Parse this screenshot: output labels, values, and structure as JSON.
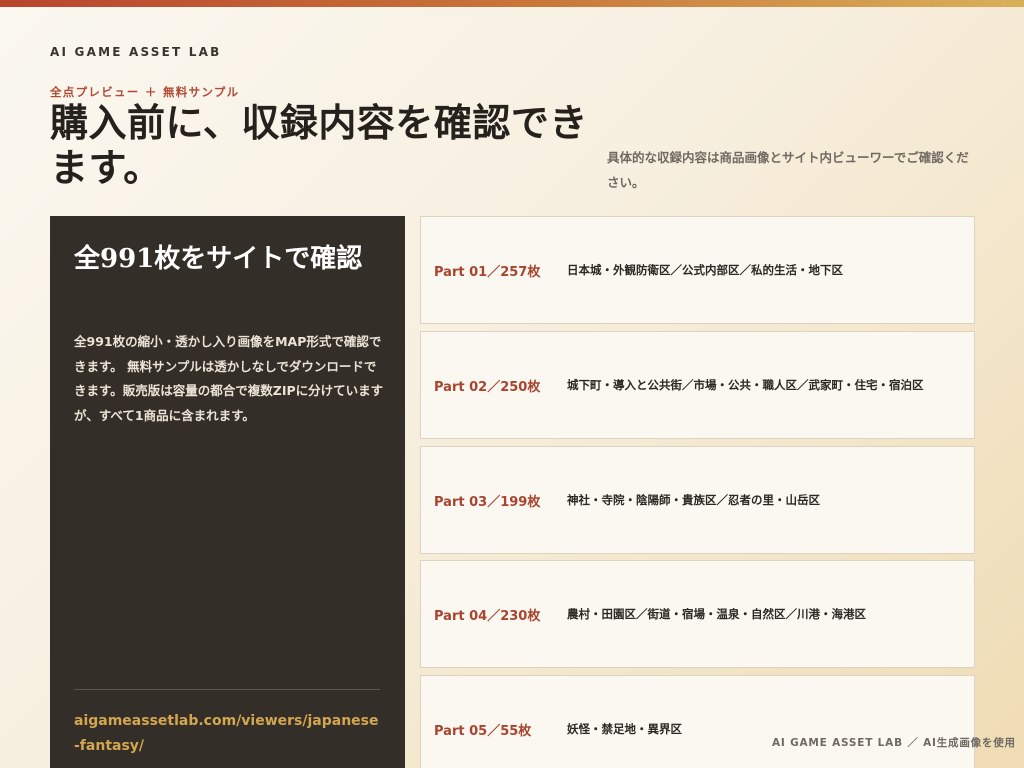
{
  "brand": "AI GAME ASSET LAB",
  "eyebrow": "全点プレビュー ＋ 無料サンプル",
  "hero": {
    "title": "購入前に、収録内容を確認できます。",
    "description": "具体的な収録内容は商品画像とサイト内ビューワーでご確認ください。"
  },
  "info_panel": {
    "title": "全991枚をサイトで確認",
    "description": "全991枚の縮小・透かし入り画像をMAP形式で確認できます。 無料サンプルは透かしなしでダウンロードできます。販売版は容量の都合で複数ZIPに分けていますが、すべて1商品に含まれます。",
    "link": "aigameassetlab.com/viewers/japanese-fantasy/"
  },
  "parts": [
    {
      "label": "Part 01／257枚",
      "areas": "日本城・外観防衛区／公式内部区／私的生活・地下区"
    },
    {
      "label": "Part 02／250枚",
      "areas": "城下町・導入と公共街／市場・公共・職人区／武家町・住宅・宿泊区"
    },
    {
      "label": "Part 03／199枚",
      "areas": "神社・寺院・陰陽師・貴族区／忍者の里・山岳区"
    },
    {
      "label": "Part 04／230枚",
      "areas": "農村・田園区／街道・宿場・温泉・自然区／川港・海港区"
    },
    {
      "label": "Part 05／55枚",
      "areas": "妖怪・禁足地・異界区"
    }
  ],
  "footer": {
    "credit": "AI GAME ASSET LAB ／ AI生成画像を使用"
  }
}
